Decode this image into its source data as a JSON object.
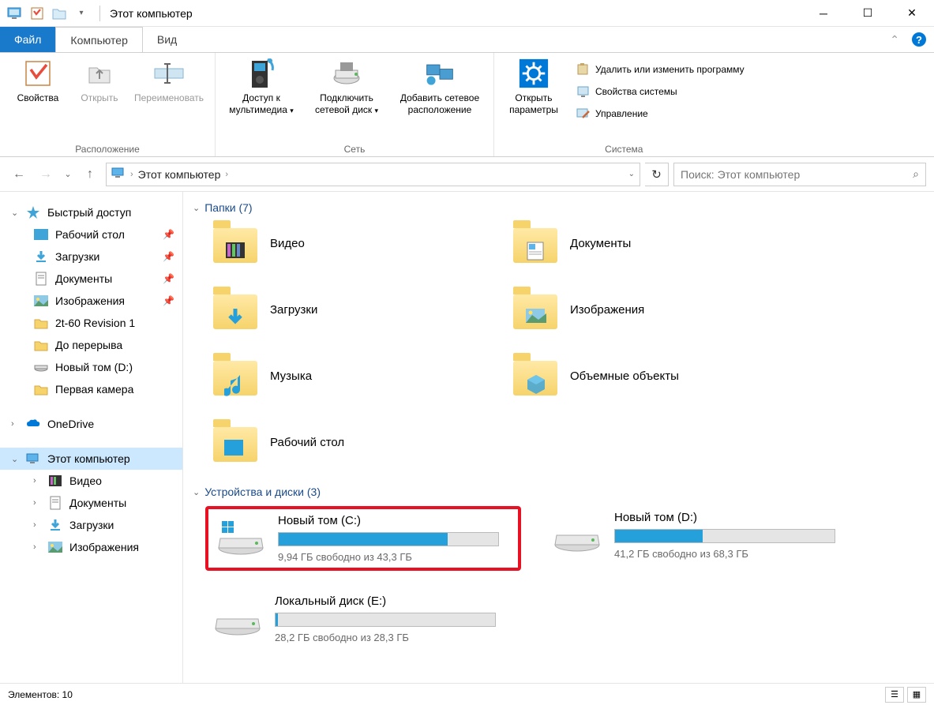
{
  "title": "Этот компьютер",
  "tabs": {
    "file": "Файл",
    "computer": "Компьютер",
    "view": "Вид"
  },
  "ribbon": {
    "groups": {
      "location": {
        "label": "Расположение",
        "properties": "Свойства",
        "open": "Открыть",
        "rename": "Переименовать"
      },
      "network": {
        "label": "Сеть",
        "media_access": "Доступ к мультимедиа",
        "map_drive": "Подключить сетевой диск",
        "add_network": "Добавить сетевое расположение"
      },
      "system": {
        "label": "Система",
        "open_settings": "Открыть параметры",
        "remove_program": "Удалить или изменить программу",
        "system_properties": "Свойства системы",
        "manage": "Управление"
      }
    }
  },
  "address": {
    "location": "Этот компьютер"
  },
  "search": {
    "placeholder": "Поиск: Этот компьютер"
  },
  "sidebar": {
    "quick_access": {
      "label": "Быстрый доступ",
      "items": [
        {
          "label": "Рабочий стол",
          "pinned": true,
          "icon": "desktop"
        },
        {
          "label": "Загрузки",
          "pinned": true,
          "icon": "downloads"
        },
        {
          "label": "Документы",
          "pinned": true,
          "icon": "documents"
        },
        {
          "label": "Изображения",
          "pinned": true,
          "icon": "pictures"
        },
        {
          "label": "2t-60 Revision 1",
          "pinned": false,
          "icon": "folder"
        },
        {
          "label": "До перерыва",
          "pinned": false,
          "icon": "folder"
        },
        {
          "label": "Новый том (D:)",
          "pinned": false,
          "icon": "drive"
        },
        {
          "label": "Первая камера",
          "pinned": false,
          "icon": "folder"
        }
      ]
    },
    "onedrive": {
      "label": "OneDrive"
    },
    "this_pc": {
      "label": "Этот компьютер",
      "items": [
        {
          "label": "Видео"
        },
        {
          "label": "Документы"
        },
        {
          "label": "Загрузки"
        },
        {
          "label": "Изображения"
        }
      ]
    }
  },
  "sections": {
    "folders": {
      "label": "Папки (7)",
      "items": [
        {
          "label": "Видео"
        },
        {
          "label": "Документы"
        },
        {
          "label": "Загрузки"
        },
        {
          "label": "Изображения"
        },
        {
          "label": "Музыка"
        },
        {
          "label": "Объемные объекты"
        },
        {
          "label": "Рабочий стол"
        }
      ]
    },
    "drives": {
      "label": "Устройства и диски (3)",
      "items": [
        {
          "name": "Новый том (C:)",
          "status": "9,94 ГБ свободно из 43,3 ГБ",
          "fill": 77,
          "highlighted": true,
          "os": true
        },
        {
          "name": "Новый том (D:)",
          "status": "41,2 ГБ свободно из 68,3 ГБ",
          "fill": 40,
          "highlighted": false
        },
        {
          "name": "Локальный диск (E:)",
          "status": "28,2 ГБ свободно из 28,3 ГБ",
          "fill": 1,
          "highlighted": false
        }
      ]
    }
  },
  "statusbar": {
    "items": "Элементов: 10"
  }
}
